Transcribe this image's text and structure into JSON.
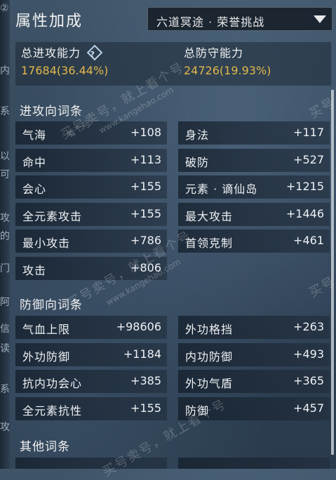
{
  "left_edge": [
    "②",
    "内",
    "系",
    "以",
    "可",
    "攻",
    "的",
    "门",
    "阿",
    "信",
    "读",
    "系",
    "攻"
  ],
  "header": {
    "title": "属性加成",
    "dropdown_selected": "六道冥途 · 荣誉挑战"
  },
  "summary": {
    "attack_label": "总进攻能力",
    "attack_value": "17684(36.44%)",
    "defense_label": "总防守能力",
    "defense_value": "24726(19.93%)",
    "help_glyph": "?"
  },
  "attack_section": {
    "title": "进攻向词条",
    "items": [
      {
        "name": "气海",
        "value": "+108"
      },
      {
        "name": "身法",
        "value": "+117"
      },
      {
        "name": "命中",
        "value": "+113"
      },
      {
        "name": "破防",
        "value": "+527"
      },
      {
        "name": "会心",
        "value": "+155"
      },
      {
        "name": "元素 · 谪仙岛",
        "value": "+1215"
      },
      {
        "name": "全元素攻击",
        "value": "+155"
      },
      {
        "name": "最大攻击",
        "value": "+1446"
      },
      {
        "name": "最小攻击",
        "value": "+786"
      },
      {
        "name": "首领克制",
        "value": "+461"
      },
      {
        "name": "攻击",
        "value": "+806"
      }
    ]
  },
  "defense_section": {
    "title": "防御向词条",
    "items": [
      {
        "name": "气血上限",
        "value": "+98606"
      },
      {
        "name": "外功格挡",
        "value": "+263"
      },
      {
        "name": "外功防御",
        "value": "+1184"
      },
      {
        "name": "内功防御",
        "value": "+493"
      },
      {
        "name": "抗内功会心",
        "value": "+385"
      },
      {
        "name": "外功气盾",
        "value": "+365"
      },
      {
        "name": "全元素抗性",
        "value": "+155"
      },
      {
        "name": "防御",
        "value": "+457"
      }
    ]
  },
  "other_section": {
    "title": "其他词条"
  },
  "watermarks": {
    "main": "买号卖号，就上看个号",
    "url": "www.kangehao.com",
    "badge": "看个号",
    "corner": "买号"
  }
}
